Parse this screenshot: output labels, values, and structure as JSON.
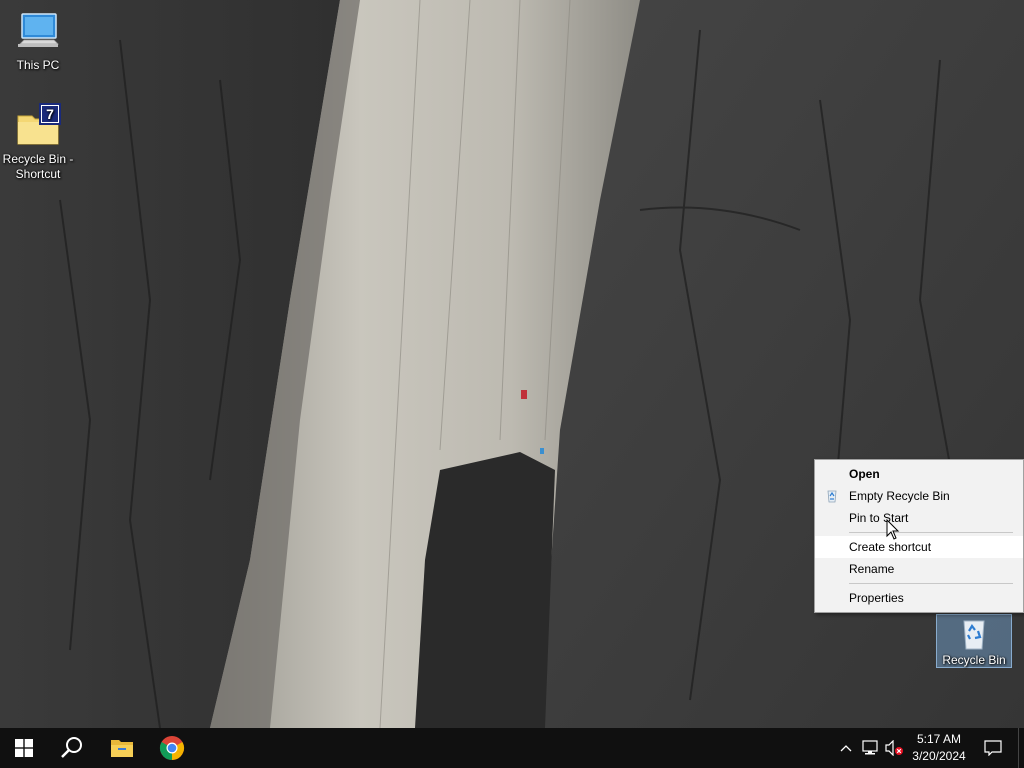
{
  "desktop": {
    "wallpaper": "granite-cliff-with-climbers",
    "icons": [
      {
        "label": "This PC",
        "icon": "computer-icon"
      },
      {
        "label": "Recycle Bin - Shortcut",
        "icon": "shortcut-folder-icon"
      },
      {
        "label": "Recycle Bin",
        "icon": "recycle-bin-icon",
        "selected": true
      }
    ]
  },
  "context_menu": {
    "items": [
      {
        "label": "Open",
        "bold": true
      },
      {
        "label": "Empty Recycle Bin",
        "icon": "recycle-icon"
      },
      {
        "label": "Pin to Start"
      },
      {
        "label": "Create shortcut",
        "hovered": true
      },
      {
        "label": "Rename"
      },
      {
        "label": "Properties"
      }
    ]
  },
  "taskbar": {
    "start": "windows-logo-icon",
    "search": "search-icon",
    "pinned": [
      "file-explorer-icon",
      "chrome-icon"
    ],
    "tray": {
      "icons": [
        "chevron-up-icon",
        "network-icon",
        "volume-muted-icon"
      ],
      "time": "5:17 AM",
      "date": "3/20/2024"
    },
    "action_center": "notification-icon"
  },
  "colors": {
    "taskbar_bg": "#101010",
    "menu_bg": "#f2f2f2",
    "menu_hover": "#ffffff",
    "selection": "#78aadc"
  }
}
